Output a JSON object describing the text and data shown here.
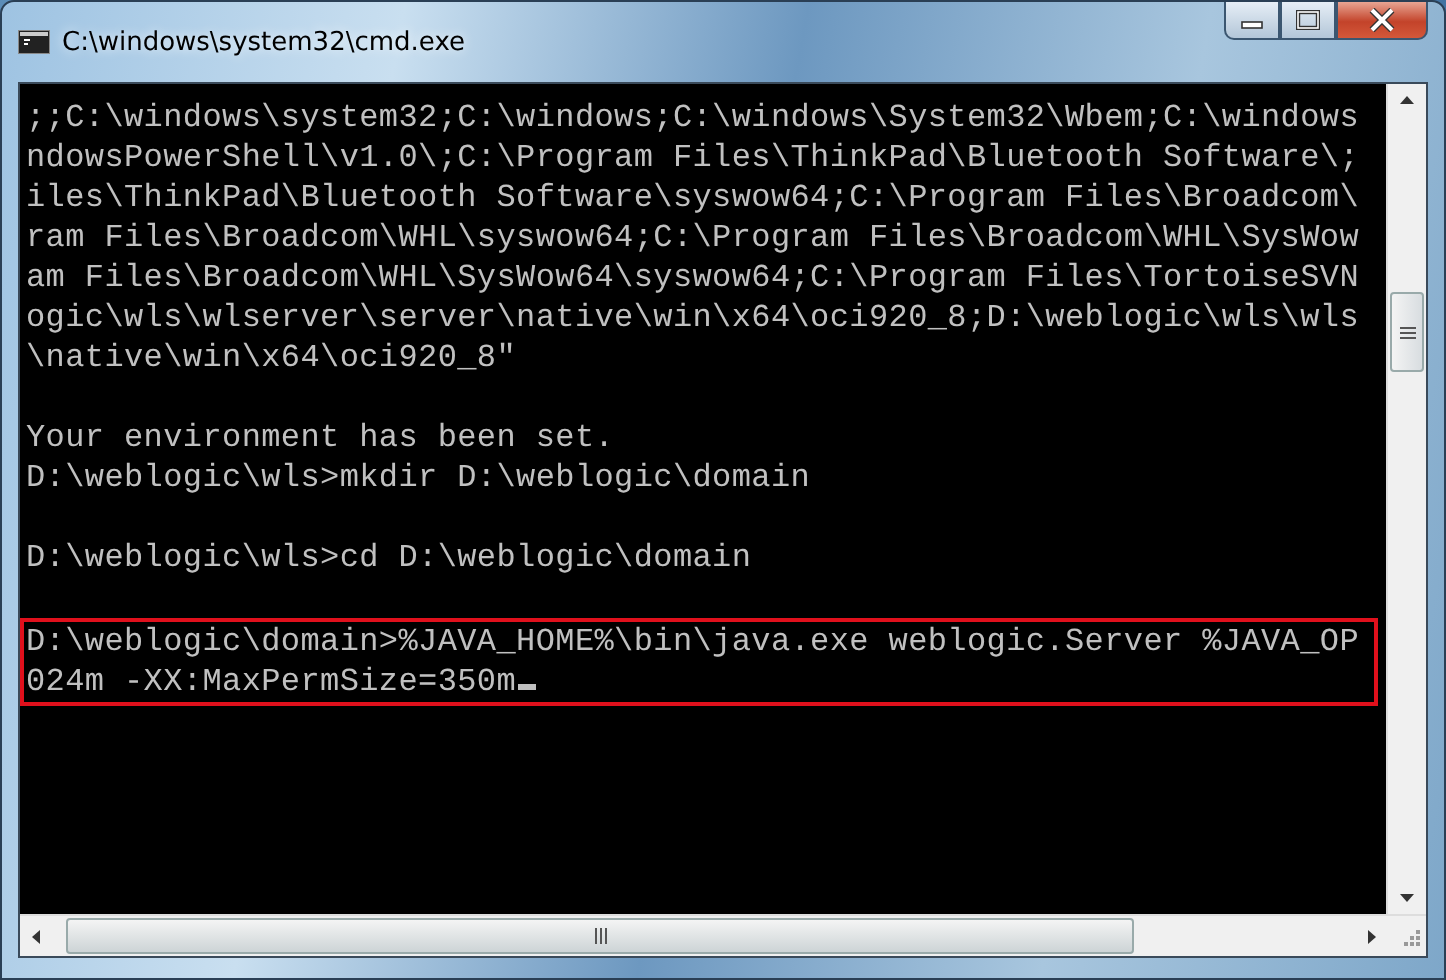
{
  "window": {
    "title": "C:\\windows\\system32\\cmd.exe"
  },
  "console": {
    "lines": [
      {
        "kind": "text",
        "text": ";;C:\\windows\\system32;C:\\windows;C:\\windows\\System32\\Wbem;C:\\windows"
      },
      {
        "kind": "text",
        "text": "ndowsPowerShell\\v1.0\\;C:\\Program Files\\ThinkPad\\Bluetooth Software\\;"
      },
      {
        "kind": "text",
        "text": "iles\\ThinkPad\\Bluetooth Software\\syswow64;C:\\Program Files\\Broadcom\\"
      },
      {
        "kind": "text",
        "text": "ram Files\\Broadcom\\WHL\\syswow64;C:\\Program Files\\Broadcom\\WHL\\SysWow"
      },
      {
        "kind": "text",
        "text": "am Files\\Broadcom\\WHL\\SysWow64\\syswow64;C:\\Program Files\\TortoiseSVN"
      },
      {
        "kind": "text",
        "text": "ogic\\wls\\wlserver\\server\\native\\win\\x64\\oci920_8;D:\\weblogic\\wls\\wls"
      },
      {
        "kind": "text",
        "text": "\\native\\win\\x64\\oci920_8\""
      },
      {
        "kind": "blank"
      },
      {
        "kind": "text",
        "text": "Your environment has been set."
      },
      {
        "kind": "text",
        "text": "D:\\weblogic\\wls>mkdir D:\\weblogic\\domain"
      },
      {
        "kind": "blank"
      },
      {
        "kind": "text",
        "text": "D:\\weblogic\\wls>cd D:\\weblogic\\domain"
      },
      {
        "kind": "blank"
      }
    ],
    "highlighted_lines": [
      {
        "kind": "text",
        "text": "D:\\weblogic\\domain>%JAVA_HOME%\\bin\\java.exe weblogic.Server %JAVA_OP"
      },
      {
        "kind": "text",
        "text": "024m -XX:MaxPermSize=350m"
      }
    ],
    "cursor": true
  }
}
